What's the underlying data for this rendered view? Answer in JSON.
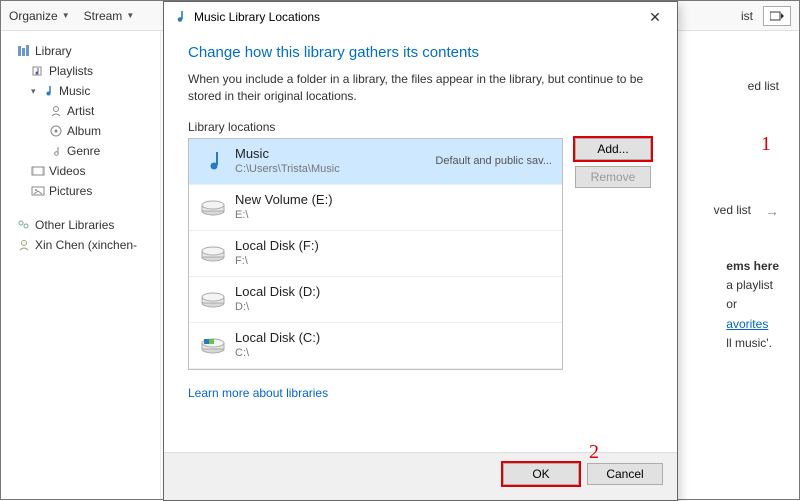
{
  "toolbar": {
    "organize": "Organize",
    "stream": "Stream",
    "right_label": "ist"
  },
  "sidebar": {
    "library": "Library",
    "playlists": "Playlists",
    "music": "Music",
    "artist": "Artist",
    "album": "Album",
    "genre": "Genre",
    "videos": "Videos",
    "pictures": "Pictures",
    "other": "Other Libraries",
    "xin": "Xin Chen (xinchen-"
  },
  "content": {
    "ed_list": "ed list",
    "ved_list": "ved list",
    "ems_here": "ems here",
    "a_playlist": "a playlist",
    "or": "or",
    "avorites": "avorites",
    "all_music": "ll music'."
  },
  "dialog": {
    "title": "Music Library Locations",
    "heading": "Change how this library gathers its contents",
    "desc": "When you include a folder in a library, the files appear in the library, but continue to be stored in their original locations.",
    "sub": "Library locations",
    "add": "Add...",
    "remove": "Remove",
    "learn": "Learn more about libraries",
    "ok": "OK",
    "cancel": "Cancel"
  },
  "locations": [
    {
      "name": "Music",
      "path": "C:\\Users\\Trista\\Music",
      "tag": "Default and public sav...",
      "icon": "music",
      "selected": true
    },
    {
      "name": "New Volume (E:)",
      "path": "E:\\",
      "tag": "",
      "icon": "drive",
      "selected": false
    },
    {
      "name": "Local Disk (F:)",
      "path": "F:\\",
      "tag": "",
      "icon": "drive",
      "selected": false
    },
    {
      "name": "Local Disk (D:)",
      "path": "D:\\",
      "tag": "",
      "icon": "drive",
      "selected": false
    },
    {
      "name": "Local Disk (C:)",
      "path": "C:\\",
      "tag": "",
      "icon": "windrive",
      "selected": false
    }
  ],
  "annotations": {
    "one": "1",
    "two": "2"
  }
}
